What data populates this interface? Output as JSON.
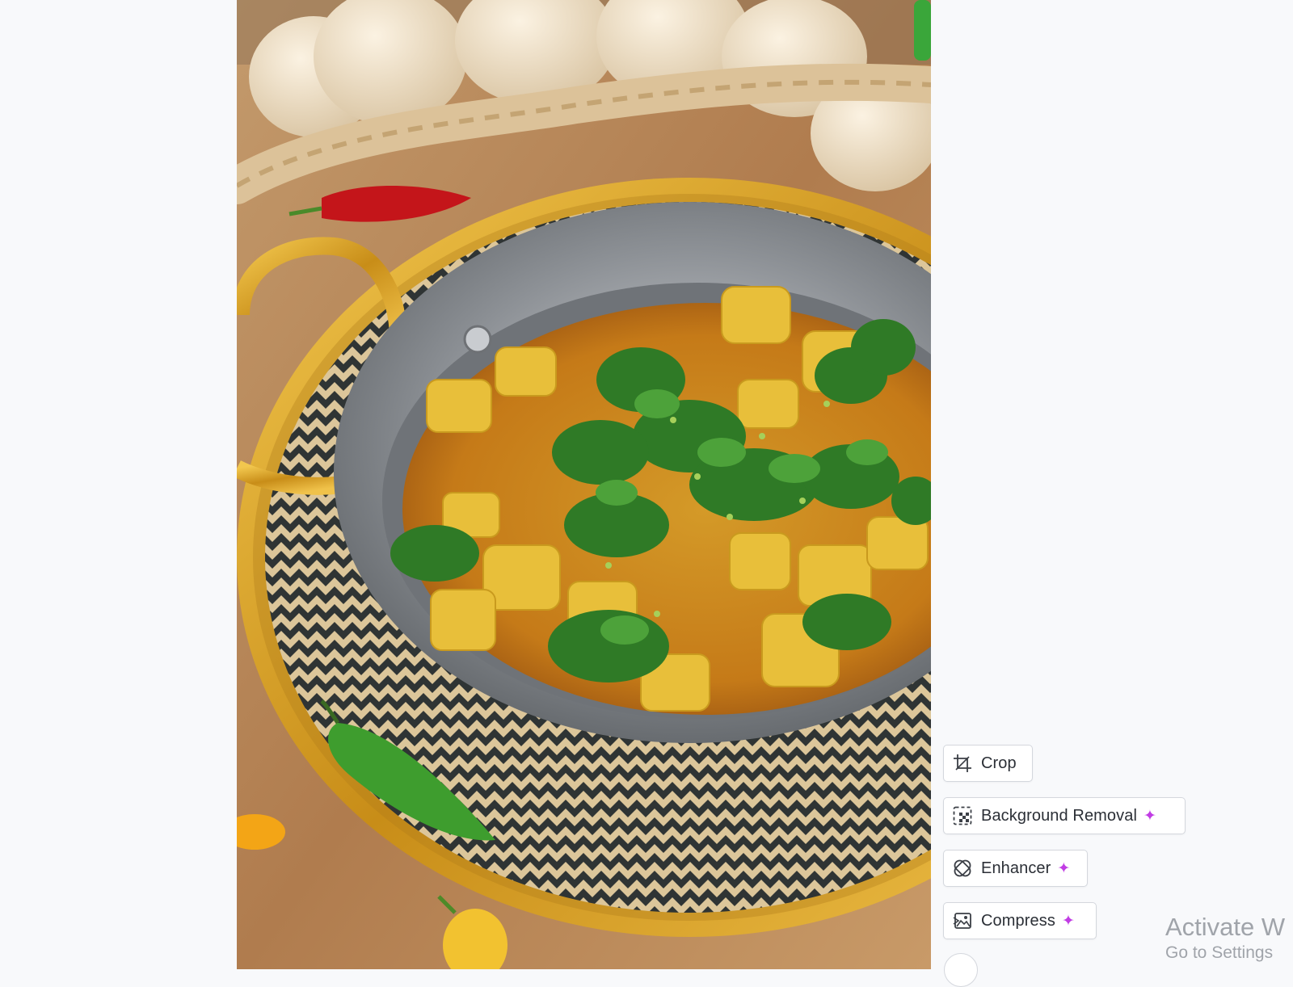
{
  "tools": {
    "crop_label": "Crop",
    "background_removal_label": "Background Removal",
    "enhancer_label": "Enhancer",
    "compress_label": "Compress",
    "sparkle_color": "#c13ce4"
  },
  "activation": {
    "title": "Activate W",
    "subtitle": "Go to Settings"
  },
  "icons": [
    "crop-icon",
    "background-removal-icon",
    "enhancer-icon",
    "compress-icon",
    "sparkle-icon"
  ],
  "colors": {
    "page_background": "#f8f9fb",
    "button_border": "#d4d7dd",
    "button_text": "#2b2f36",
    "watermark_text": "#a0a4aa"
  }
}
